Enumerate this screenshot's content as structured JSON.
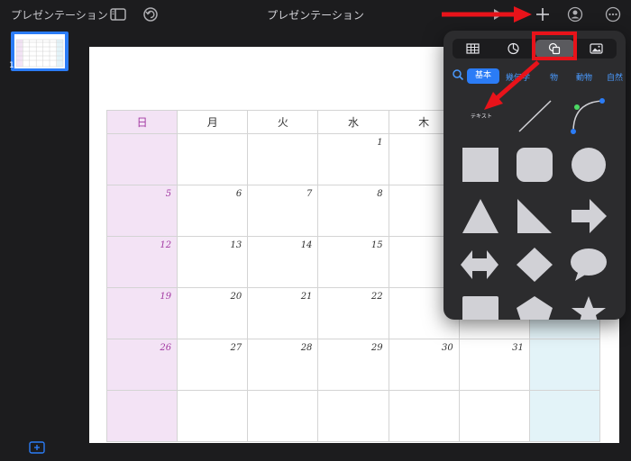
{
  "topbar": {
    "app_title": "プレゼンテーション",
    "doc_title": "プレゼンテーション"
  },
  "sidebar": {
    "slide_number": "1"
  },
  "calendar": {
    "weekdays": [
      {
        "label": "日",
        "cls": "sun"
      },
      {
        "label": "月",
        "cls": ""
      },
      {
        "label": "火",
        "cls": ""
      },
      {
        "label": "水",
        "cls": ""
      },
      {
        "label": "木",
        "cls": ""
      },
      {
        "label": "",
        "cls": ""
      },
      {
        "label": "",
        "cls": "sat"
      }
    ],
    "weeks": [
      [
        "",
        "",
        "",
        "1",
        "",
        "",
        ""
      ],
      [
        "5",
        "6",
        "7",
        "8",
        "",
        "",
        ""
      ],
      [
        "12",
        "13",
        "14",
        "15",
        "",
        "",
        ""
      ],
      [
        "19",
        "20",
        "21",
        "22",
        "",
        "",
        ""
      ],
      [
        "26",
        "27",
        "28",
        "29",
        "30",
        "31",
        ""
      ],
      [
        "",
        "",
        "",
        "",
        "",
        "",
        ""
      ]
    ]
  },
  "popover": {
    "categories": {
      "basic": "基本",
      "geometry": "幾何学",
      "object": "物",
      "animals": "動物",
      "nature": "自然"
    },
    "text_label": "テキスト"
  },
  "colors": {
    "accent": "#2b7cf6",
    "annotation": "#e8131a",
    "shape_fill": "#d1d1d6",
    "sunday_bg": "#f3e3f5",
    "saturday_bg": "#e3f3f8"
  }
}
